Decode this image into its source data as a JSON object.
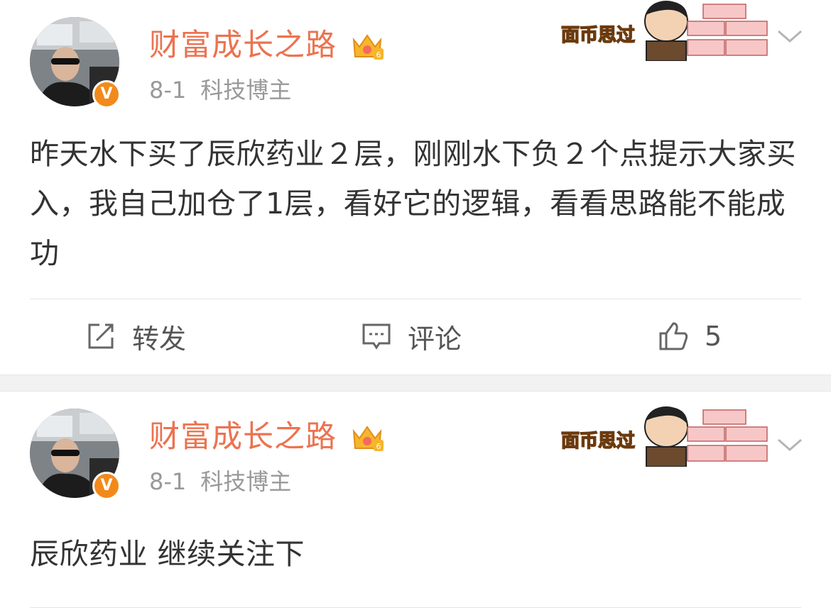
{
  "posts": [
    {
      "username": "财富成长之路",
      "date": "8-1",
      "source": "科技博主",
      "sticker_text": "面币思过",
      "badge_letter": "V",
      "crown_level": "6",
      "text": "昨天水下买了辰欣药业２层，刚刚水下负２个点提示大家买入，我自己加仓了1层，看好它的逻辑，看看思路能不能成功",
      "actions": {
        "repost_label": "转发",
        "comment_label": "评论",
        "like_count": "5"
      }
    },
    {
      "username": "财富成长之路",
      "date": "8-1",
      "source": "科技博主",
      "sticker_text": "面币思过",
      "badge_letter": "V",
      "crown_level": "6",
      "text": "辰欣药业 继续关注下"
    }
  ],
  "colors": {
    "username": "#eb7350",
    "meta": "#999999",
    "badge": "#f28a1b",
    "separator": "#f2f2f2"
  },
  "icons": [
    "more-chevron-icon",
    "crown-icon",
    "repost-icon",
    "comment-icon",
    "like-icon"
  ]
}
